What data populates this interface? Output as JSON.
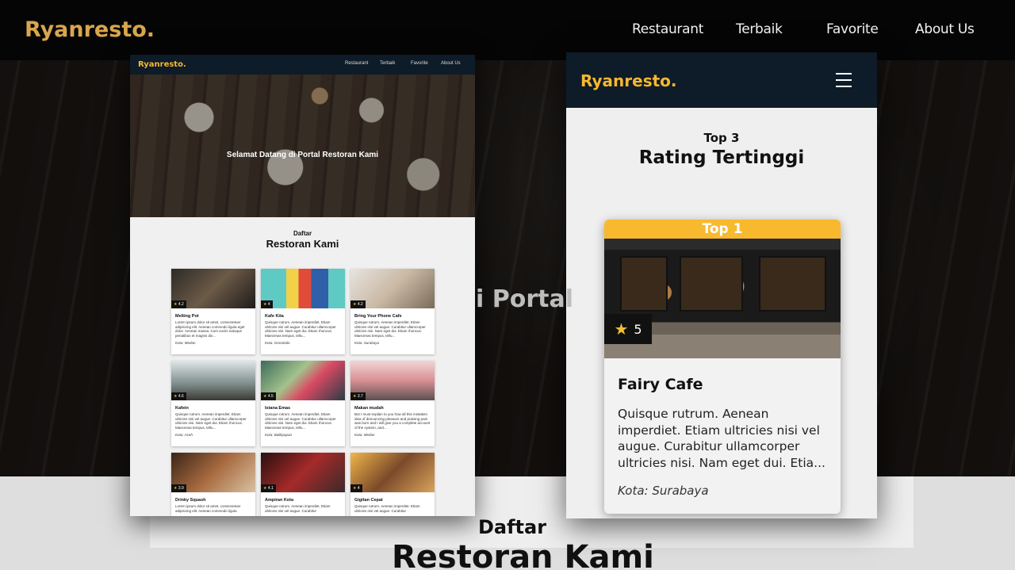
{
  "background": {
    "logo": "Ryanresto.",
    "menu": [
      "Restaurant",
      "Terbaik",
      "Favorite",
      "About Us"
    ],
    "hero_text_fragment": "i Portal",
    "section_subtitle": "Daftar",
    "section_title": "Restoran Kami"
  },
  "desktop": {
    "logo": "Ryanresto.",
    "menu": [
      "Restaurant",
      "Terbaik",
      "Favorite",
      "About Us"
    ],
    "hero_text": "Selamat Datang di Portal Restoran Kami",
    "section_subtitle": "Daftar",
    "section_title": "Restoran Kami",
    "restaurants": [
      {
        "name": "Melting Pot",
        "rating": "4.2",
        "desc": "Lorem ipsum dolor sit amet, consectetuer adipiscing elit. Aenean commodo ligula eget dolor. Aenean massa. Cum sociis natoque penatibus et magnis dis...",
        "city": "Kota: Medan"
      },
      {
        "name": "Kafe Kita",
        "rating": "4",
        "desc": "Quisque rutrum. Aenean imperdiet. Etiam ultricies nisi vel augue. Curabitur ullamcorper ultricies nisi. Nam eget dui. Etiam rhoncus. Maecenas tempus, tellu...",
        "city": "Kota: Gorontalo"
      },
      {
        "name": "Bring Your Phone Cafe",
        "rating": "4.2",
        "desc": "Quisque rutrum. Aenean imperdiet. Etiam ultricies nisi vel augue. Curabitur ullamcorper ultricies nisi. Nam eget dui. Etiam rhoncus. Maecenas tempus, tellu...",
        "city": "Kota: Surabaya"
      },
      {
        "name": "Kafein",
        "rating": "4.6",
        "desc": "Quisque rutrum. Aenean imperdiet. Etiam ultricies nisi vel augue. Curabitur ullamcorper ultricies nisi. Nam eget dui. Etiam rhoncus. Maecenas tempus, tellu...",
        "city": "Kota: Aceh"
      },
      {
        "name": "Istana Emas",
        "rating": "4.5",
        "desc": "Quisque rutrum. Aenean imperdiet. Etiam ultricies nisi vel augue. Curabitur ullamcorper ultricies nisi. Nam eget dui. Etiam rhoncus. Maecenas tempus, tellu...",
        "city": "Kota: Balikpapan"
      },
      {
        "name": "Makan mudah",
        "rating": "3.7",
        "desc": "But I must explain to you how all this mistaken idea of denouncing pleasure and praising pain was born and I will give you a complete account of the system, and...",
        "city": "Kota: Medan"
      },
      {
        "name": "Drinky Squash",
        "rating": "3.9",
        "desc": "Lorem ipsum dolor sit amet, consectetuer adipiscing elit. Aenean commodo ligula",
        "city": ""
      },
      {
        "name": "Ampiran Kota",
        "rating": "4.1",
        "desc": "Quisque rutrum. Aenean imperdiet. Etiam ultricies nisi vel augue. Curabitur",
        "city": ""
      },
      {
        "name": "Gigitan Cepat",
        "rating": "4",
        "desc": "Quisque rutrum. Aenean imperdiet. Etiam ultricies nisi vel augue. Curabitur",
        "city": ""
      }
    ]
  },
  "mobile": {
    "logo": "Ryanresto.",
    "top_label": "Top 3",
    "heading": "Rating Tertinggi",
    "card": {
      "badge": "Top 1",
      "rating": "5",
      "name": "Fairy Cafe",
      "desc": "Quisque rutrum. Aenean imperdiet. Etiam ultricies nisi vel augue. Curabitur ullamcorper ultricies nisi. Nam eget dui. Etia...",
      "city": "Kota: Surabaya"
    }
  }
}
